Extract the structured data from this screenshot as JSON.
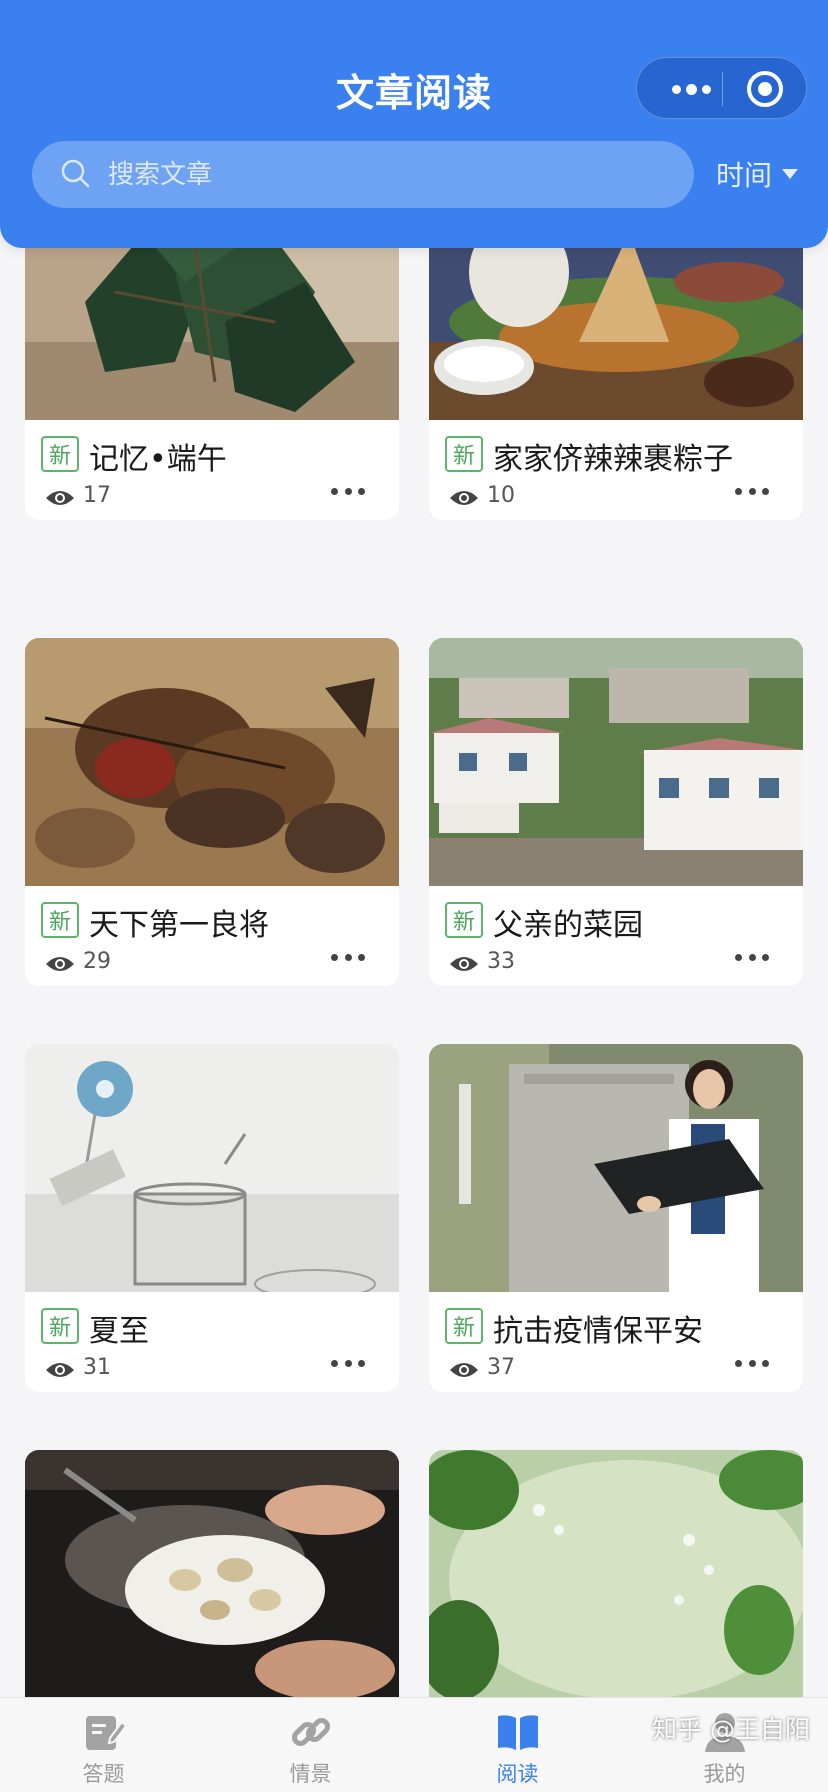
{
  "header": {
    "title": "文章阅读",
    "capsule_more_icon": "more-dots-icon",
    "capsule_close_icon": "target-icon"
  },
  "search": {
    "placeholder": "搜索文章",
    "icon": "search-icon"
  },
  "sort": {
    "label": "时间",
    "icon": "caret-down-icon"
  },
  "articles": [
    {
      "badge": "新",
      "title": "记忆•端午",
      "views": "17"
    },
    {
      "badge": "新",
      "title": "家家侪辣辣裹粽子",
      "views": "10"
    },
    {
      "badge": "新",
      "title": "天下第一良将",
      "views": "29"
    },
    {
      "badge": "新",
      "title": "父亲的菜园",
      "views": "33"
    },
    {
      "badge": "新",
      "title": "夏至",
      "views": "31"
    },
    {
      "badge": "新",
      "title": "抗击疫情保平安",
      "views": "37"
    },
    {
      "badge": "",
      "title": "",
      "views": ""
    },
    {
      "badge": "",
      "title": "",
      "views": ""
    }
  ],
  "tabbar": {
    "items": [
      {
        "label": "答题",
        "icon": "edit-icon"
      },
      {
        "label": "情景",
        "icon": "link-icon"
      },
      {
        "label": "阅读",
        "icon": "book-icon"
      },
      {
        "label": "我的",
        "icon": "user-icon"
      }
    ],
    "active_index": 2
  },
  "watermark": "知乎 @王自阳",
  "colors": {
    "accent": "#3a80ee",
    "badge": "#4aa85a",
    "background": "#f5f5f7"
  }
}
